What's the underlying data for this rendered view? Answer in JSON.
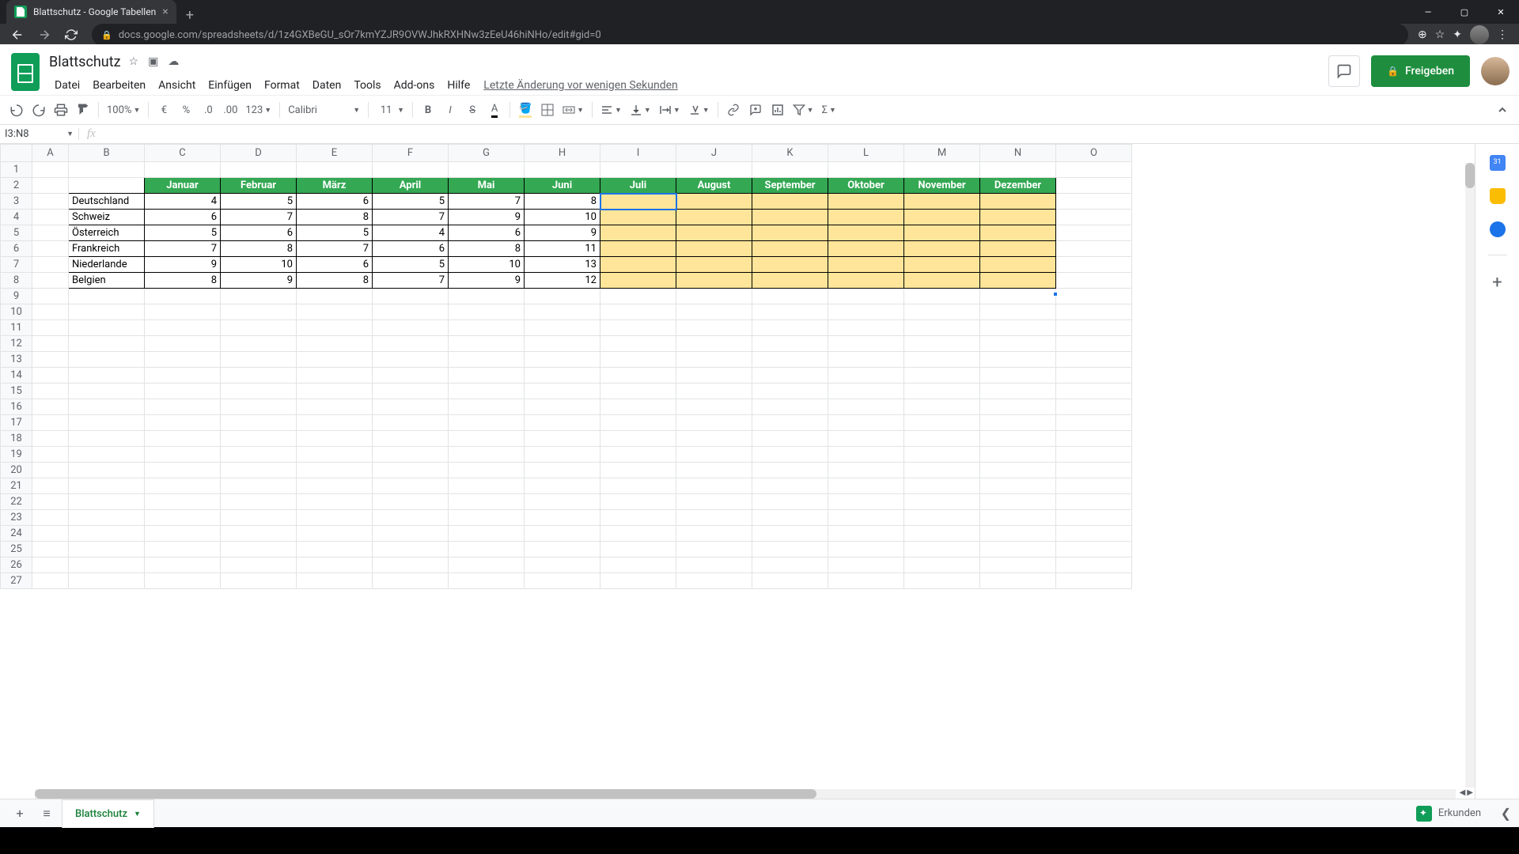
{
  "browser": {
    "tab_title": "Blattschutz - Google Tabellen",
    "url": "docs.google.com/spreadsheets/d/1z4GXBeGU_sOr7kmYZJR9OVWJhkRXHNw3zEeU46hiNHo/edit#gid=0"
  },
  "doc": {
    "title": "Blattschutz",
    "last_edit": "Letzte Änderung vor wenigen Sekunden",
    "share_label": "Freigeben"
  },
  "menu": {
    "items": [
      "Datei",
      "Bearbeiten",
      "Ansicht",
      "Einfügen",
      "Format",
      "Daten",
      "Tools",
      "Add-ons",
      "Hilfe"
    ]
  },
  "toolbar": {
    "zoom": "100%",
    "format_123": "123",
    "font_name": "Calibri",
    "font_size": "11"
  },
  "name_box": "I3:N8",
  "columns": [
    "A",
    "B",
    "C",
    "D",
    "E",
    "F",
    "G",
    "H",
    "I",
    "J",
    "K",
    "L",
    "M",
    "N",
    "O"
  ],
  "row_count": 27,
  "months": [
    "Januar",
    "Februar",
    "März",
    "April",
    "Mai",
    "Juni",
    "Juli",
    "August",
    "September",
    "Oktober",
    "November",
    "Dezember"
  ],
  "countries": [
    "Deutschland",
    "Schweiz",
    "Österreich",
    "Frankreich",
    "Niederlande",
    "Belgien"
  ],
  "values": [
    [
      4,
      5,
      6,
      5,
      7,
      8
    ],
    [
      6,
      7,
      8,
      7,
      9,
      10
    ],
    [
      5,
      6,
      5,
      4,
      6,
      9
    ],
    [
      7,
      8,
      7,
      6,
      8,
      11
    ],
    [
      9,
      10,
      6,
      5,
      10,
      13
    ],
    [
      8,
      9,
      8,
      7,
      9,
      12
    ]
  ],
  "sheet_tab": "Blattschutz",
  "explore_label": "Erkunden",
  "chart_data": {
    "type": "table",
    "row_labels": [
      "Deutschland",
      "Schweiz",
      "Österreich",
      "Frankreich",
      "Niederlande",
      "Belgien"
    ],
    "col_labels": [
      "Januar",
      "Februar",
      "März",
      "April",
      "Mai",
      "Juni"
    ],
    "values": [
      [
        4,
        5,
        6,
        5,
        7,
        8
      ],
      [
        6,
        7,
        8,
        7,
        9,
        10
      ],
      [
        5,
        6,
        5,
        4,
        6,
        9
      ],
      [
        7,
        8,
        7,
        6,
        8,
        11
      ],
      [
        9,
        10,
        6,
        5,
        10,
        13
      ],
      [
        8,
        9,
        8,
        7,
        9,
        12
      ]
    ]
  }
}
